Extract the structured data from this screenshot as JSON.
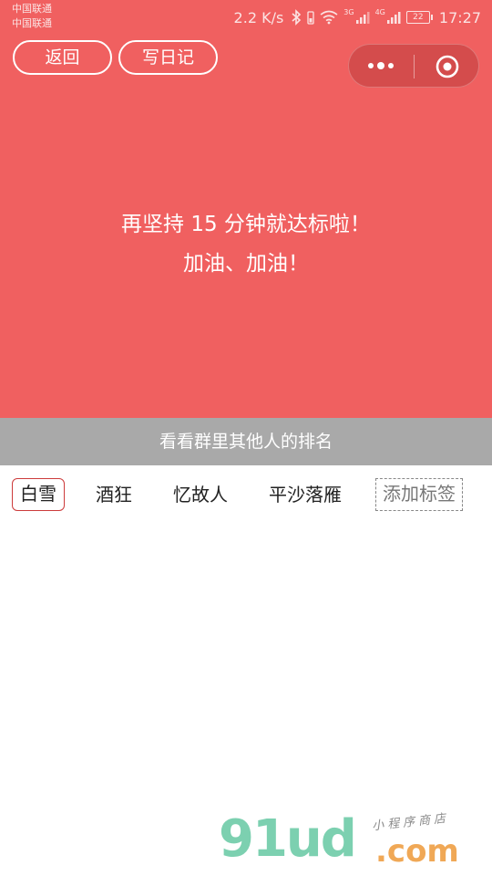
{
  "status_bar": {
    "carrier_1": "中国联通",
    "carrier_2": "中国联通",
    "speed": "2.2 K/s",
    "net_tag_1": "3G",
    "net_tag_2": "4G",
    "battery": "22",
    "time": "17:27"
  },
  "nav": {
    "back_label": "返回",
    "diary_label": "写日记"
  },
  "message": {
    "line_1": "再坚持 15 分钟就达标啦！",
    "line_2": "加油、加油！"
  },
  "rank_bar": {
    "label": "看看群里其他人的排名"
  },
  "tags": {
    "items": [
      {
        "label": "白雪"
      },
      {
        "label": "酒狂"
      },
      {
        "label": "忆故人"
      },
      {
        "label": "平沙落雁"
      }
    ],
    "add_label": "添加标签"
  },
  "watermark": {
    "logo": "91ud",
    "domain": ".com",
    "subtitle": "小程序商店"
  },
  "colors": {
    "hero": "#f06060",
    "rank_bar": "#a9a9a9",
    "active_tag_border": "#cc3b3b"
  },
  "icons": [
    "bluetooth-icon",
    "wifi-icon",
    "signal-icon",
    "battery-icon",
    "more-dots-icon",
    "close-target-icon"
  ]
}
